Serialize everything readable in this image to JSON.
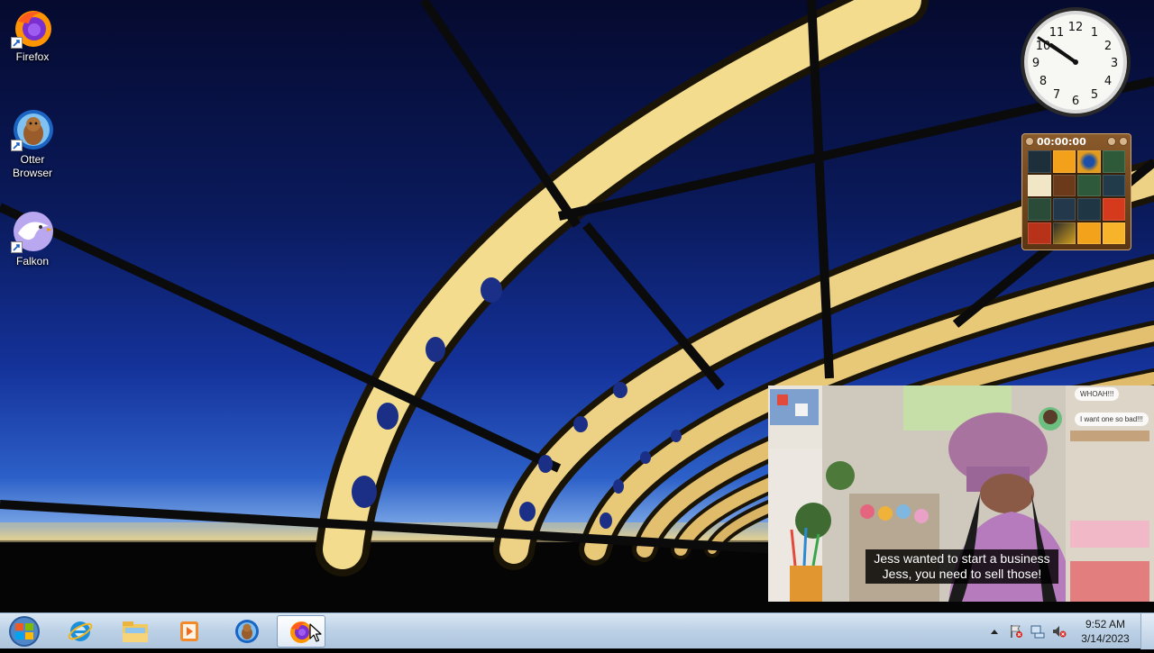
{
  "desktop": {
    "icons": [
      {
        "label": "Firefox"
      },
      {
        "label": "Otter Browser"
      },
      {
        "label": "Falkon"
      }
    ]
  },
  "gadgets": {
    "puzzle": {
      "timer": "00:00:00"
    }
  },
  "video": {
    "subtitle_line1": "Jess wanted to start a business",
    "subtitle_line2": "Jess, you need to sell those!",
    "chat_whoah": "WHOAH!!!",
    "chat_want": "I want one so bad!!!"
  },
  "taskbar": {
    "pinned": [
      {
        "name": "Start"
      },
      {
        "name": "Internet Explorer"
      },
      {
        "name": "Windows Explorer"
      },
      {
        "name": "Media Player"
      },
      {
        "name": "Otter Browser"
      },
      {
        "name": "Firefox"
      }
    ],
    "clock": {
      "time": "9:52 AM",
      "date": "3/14/2023"
    }
  },
  "colors": {
    "taskbar_top": "#d9e6f3",
    "taskbar_bottom": "#adc4dc",
    "sky_top": "#050a2e",
    "bridge_gold": "#f2d98a"
  }
}
